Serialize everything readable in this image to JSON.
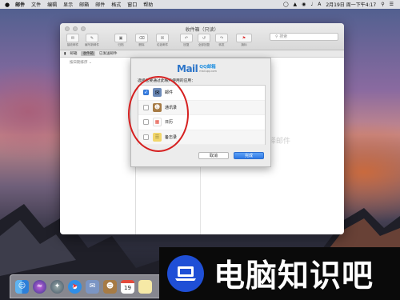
{
  "menubar": {
    "apple": "",
    "items": [
      "邮件",
      "文件",
      "编辑",
      "显示",
      "邮箱",
      "邮件",
      "格式",
      "窗口",
      "帮助"
    ],
    "clock": "2月19日 周一下午4:17"
  },
  "window": {
    "title": "收件箱（只读）",
    "toolbar": {
      "get_mail": "接收邮件",
      "compose": "编写新邮件",
      "archive": "归档",
      "delete": "删除",
      "junk": "垃圾邮件",
      "reply": "回复",
      "reply_all": "全部回复",
      "forward": "转发",
      "flag": "旗标",
      "search_placeholder": "搜索"
    },
    "favorites": [
      "邮箱",
      "收件箱",
      "已发送邮件"
    ],
    "favorites_selected": "收件箱",
    "sort_label": "按日期排序",
    "background_text": "选择邮件"
  },
  "sheet": {
    "logo": {
      "mark": "Mail",
      "brand": "QQ邮箱",
      "url": "mail.qq.com"
    },
    "title": "选择您要通过此帐户使用的应用：",
    "apps": [
      {
        "label": "邮件",
        "checked": true,
        "icon": "mail-stamp-icon",
        "color": "#6c8ab8"
      },
      {
        "label": "通讯录",
        "checked": false,
        "icon": "contacts-icon",
        "color": "#a77b45"
      },
      {
        "label": "日历",
        "checked": false,
        "icon": "calendar-icon",
        "color": "#e34a3b"
      },
      {
        "label": "备忘录",
        "checked": false,
        "icon": "notes-icon",
        "color": "#f1d66b"
      }
    ],
    "cancel": "取消",
    "done": "完成"
  },
  "annotation": {
    "color": "#d62020"
  },
  "dock": {
    "items": [
      "finder-icon",
      "siri-icon",
      "launchpad-icon",
      "safari-icon",
      "mail-icon",
      "contacts-icon",
      "calendar-icon",
      "notes-icon"
    ],
    "calendar_day": "19"
  },
  "watermark": {
    "text": "电脑知识吧"
  }
}
